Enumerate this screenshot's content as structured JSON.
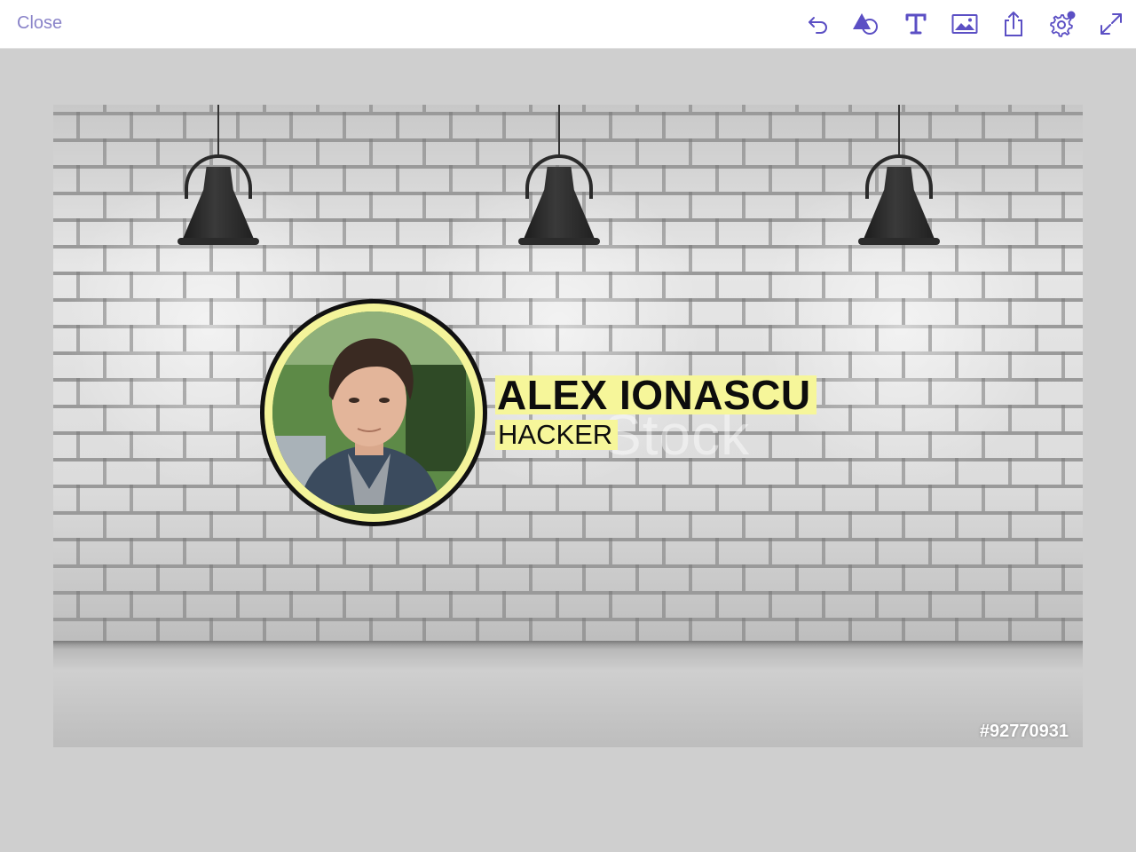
{
  "toolbar": {
    "close_label": "Close",
    "tools": [
      {
        "icon": "undo-icon"
      },
      {
        "icon": "shapes-icon"
      },
      {
        "icon": "text-icon"
      },
      {
        "icon": "image-icon"
      },
      {
        "icon": "share-icon"
      },
      {
        "icon": "settings-icon",
        "badge": true
      },
      {
        "icon": "expand-icon"
      }
    ],
    "accent_color": "#5b4fc4"
  },
  "canvas": {
    "watermark": "Stock",
    "stock_id": "#92770931",
    "profile": {
      "name": "ALEX IONASCU",
      "role": "HACKER",
      "highlight_color": "#f6f69a"
    }
  }
}
